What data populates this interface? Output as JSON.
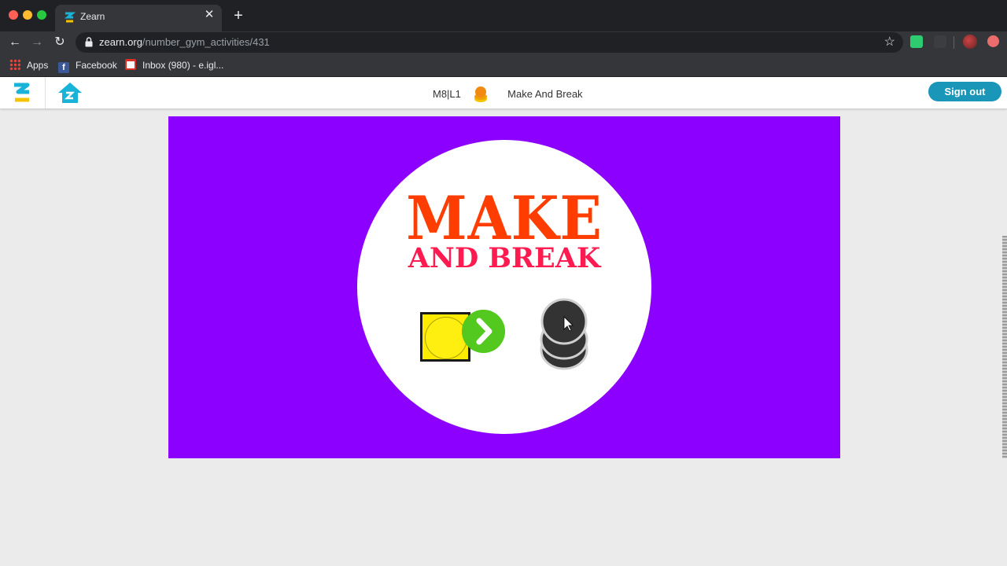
{
  "browser": {
    "tab": {
      "title": "Zearn"
    },
    "url": {
      "host": "zearn.org",
      "path": "/number_gym_activities/431"
    },
    "bookmarks": [
      {
        "label": "Apps"
      },
      {
        "label": "Facebook"
      },
      {
        "label": "Inbox (980) - e.igl..."
      }
    ]
  },
  "header": {
    "lesson_code": "M8|L1",
    "activity_name": "Make And Break",
    "signout_label": "Sign out"
  },
  "activity": {
    "title_main": "MAKE",
    "title_sub": "AND BREAK"
  },
  "colors": {
    "stage_background": "#8c00ff",
    "title_main": "#ff3d00",
    "title_sub": "#ff1a4f",
    "accent": "#1a96b9",
    "arrow_button": "#53c81f",
    "make_block": "#ffeb00",
    "coin_stack": "#333333"
  },
  "icons": [
    "zearn-logo-icon",
    "home-icon",
    "activity-coin-icon",
    "arrow-right-icon",
    "coin-stack-icon",
    "lock-icon",
    "star-icon"
  ]
}
